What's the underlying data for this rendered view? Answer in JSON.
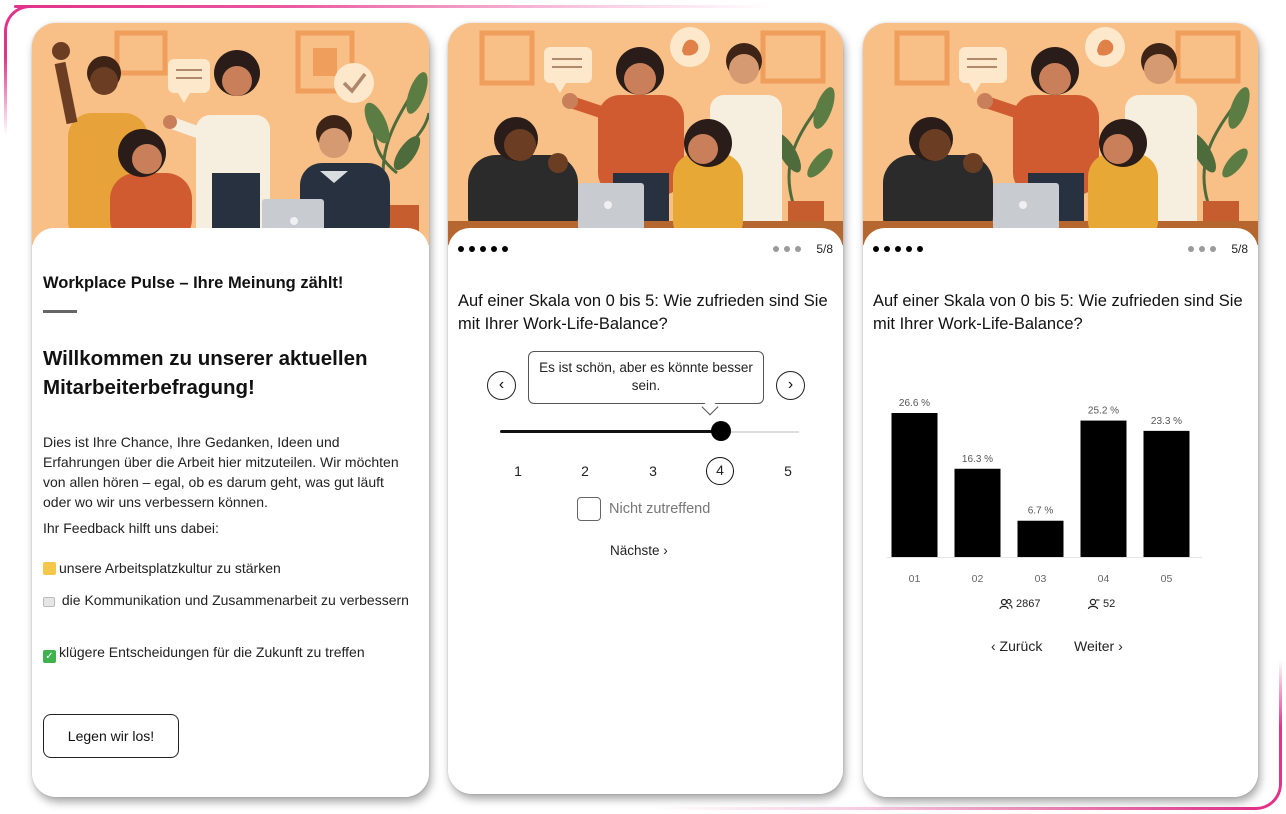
{
  "welcome": {
    "survey_title": "Workplace Pulse – Ihre Meinung zählt!",
    "heading": "Willkommen zu unserer aktuellen Mitarbeiterbefragung!",
    "intro": "Dies ist Ihre Chance, Ihre Gedanken, Ideen und Erfahrungen über die Arbeit hier mitzuteilen. Wir möchten von allen hören – egal, ob es darum geht, was gut läuft oder wo wir uns verbessern können.",
    "feedback_label": "Ihr Feedback hilft uns dabei:",
    "benefits": [
      {
        "icon": "flexed-biceps-icon",
        "text": "unsere Arbeitsplatzkultur zu stärken"
      },
      {
        "icon": "speech-balloon-icon",
        "text": "die Kommunikation und Zusammenarbeit zu verbessern"
      },
      {
        "icon": "check-mark-button-icon",
        "text": "klügere Entscheidungen für die Zukunft zu treffen"
      }
    ],
    "start_button": "Legen wir los!"
  },
  "question": {
    "progress": {
      "current": 5,
      "total": 8,
      "label": "5/8"
    },
    "text": "Auf einer Skala von 0 bis 5: Wie zufrieden sind Sie mit Ihrer Work-Life-Balance?",
    "tooltip": "Es ist schön, aber es könnte besser sein.",
    "scale": [
      "1",
      "2",
      "3",
      "4",
      "5"
    ],
    "selected_value": "4",
    "prev_icon": "chevron-left-icon",
    "next_icon": "chevron-right-icon",
    "not_applicable": "Nicht zutreffend",
    "next_button": "Nächste ›"
  },
  "results": {
    "progress": {
      "current": 5,
      "total": 8,
      "label": "5/8"
    },
    "text": "Auf einer Skala von 0 bis 5: Wie zufrieden sind Sie mit Ihrer Work-Life-Balance?",
    "participants_count": "2867",
    "participants_icon": "users-icon",
    "respondents_count": "52",
    "respondents_icon": "user-icon",
    "back_button": "‹ Zurück",
    "forward_button": "Weiter ›"
  },
  "chart_data": {
    "type": "bar",
    "categories": [
      "01",
      "02",
      "03",
      "04",
      "05"
    ],
    "values": [
      26.6,
      16.3,
      6.7,
      25.2,
      23.3
    ],
    "value_labels": [
      "26.6 %",
      "16.3 %",
      "6.7 %",
      "25.2 %",
      "23.3 %"
    ],
    "ylim": [
      0,
      26.6
    ],
    "grid": false,
    "bar_color": "#000000"
  },
  "colors": {
    "accent": "#e2338a",
    "hero_background": "#f8bf86"
  }
}
